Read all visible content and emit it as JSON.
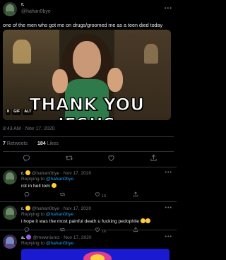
{
  "main_tweet": {
    "name": "r.",
    "handle": "@hahan0bye",
    "more_icon": "more-horizontal-icon",
    "text": "one of the men who got me on drugs/groomed me as a teen died today",
    "media": {
      "caption": "THANK YOU JESUS",
      "controls": [
        "II",
        "GIF",
        "ALT"
      ]
    },
    "timestamp": "8:43 AM · Nov 17, 2020",
    "retweets_count": "7",
    "retweets_label": "Retweets",
    "likes_count": "184",
    "likes_label": "Likes",
    "actions": [
      "reply-icon",
      "retweet-icon",
      "like-icon",
      "share-icon"
    ]
  },
  "replies": [
    {
      "name": "r.",
      "handle": "@hahan0bye",
      "date": "· Nov 17, 2020",
      "replying_prefix": "Replying to",
      "replying_to": "@hahan0bye",
      "text": "rot in hell tom",
      "retweets": "",
      "likes": "10"
    },
    {
      "name": "r.",
      "handle": "@hahan0bye",
      "date": "· Nov 17, 2020",
      "replying_prefix": "Replying to",
      "replying_to": "@hahan0bye",
      "text": "i hope it was the most painful death u fucking pedophile",
      "retweets": "",
      "likes": "16"
    },
    {
      "name": "a.",
      "handle": "@mewniumz",
      "date": "· Nov 17, 2020",
      "replying_prefix": "Replying to",
      "replying_to": "@hahan0bye",
      "text": ""
    }
  ],
  "colors": {
    "background": "#000000",
    "text": "#e7e9ea",
    "muted": "#71767b",
    "link": "#1d9bf0",
    "divider": "#2f3336"
  }
}
